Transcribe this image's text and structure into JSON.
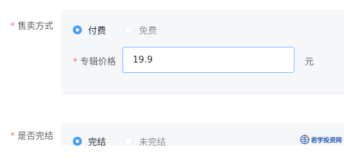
{
  "sale_mode": {
    "required_mark": "*",
    "label": "售卖方式",
    "options": [
      {
        "label": "付费",
        "selected": true
      },
      {
        "label": "免费",
        "selected": false
      }
    ]
  },
  "album_price": {
    "required_mark": "*",
    "label": "专辑价格",
    "value": "19.9",
    "unit": "元"
  },
  "completed": {
    "required_mark": "*",
    "label": "是否完结",
    "options": [
      {
        "label": "完结",
        "selected": true
      },
      {
        "label": "未完结",
        "selected": false
      }
    ]
  },
  "watermark": {
    "text": "君学投资网",
    "icon": "globe-logo-icon"
  },
  "colors": {
    "accent": "#409eff",
    "required": "#f56c6c",
    "panel_bg": "#f6f7f9",
    "watermark": "#2a59b5"
  }
}
